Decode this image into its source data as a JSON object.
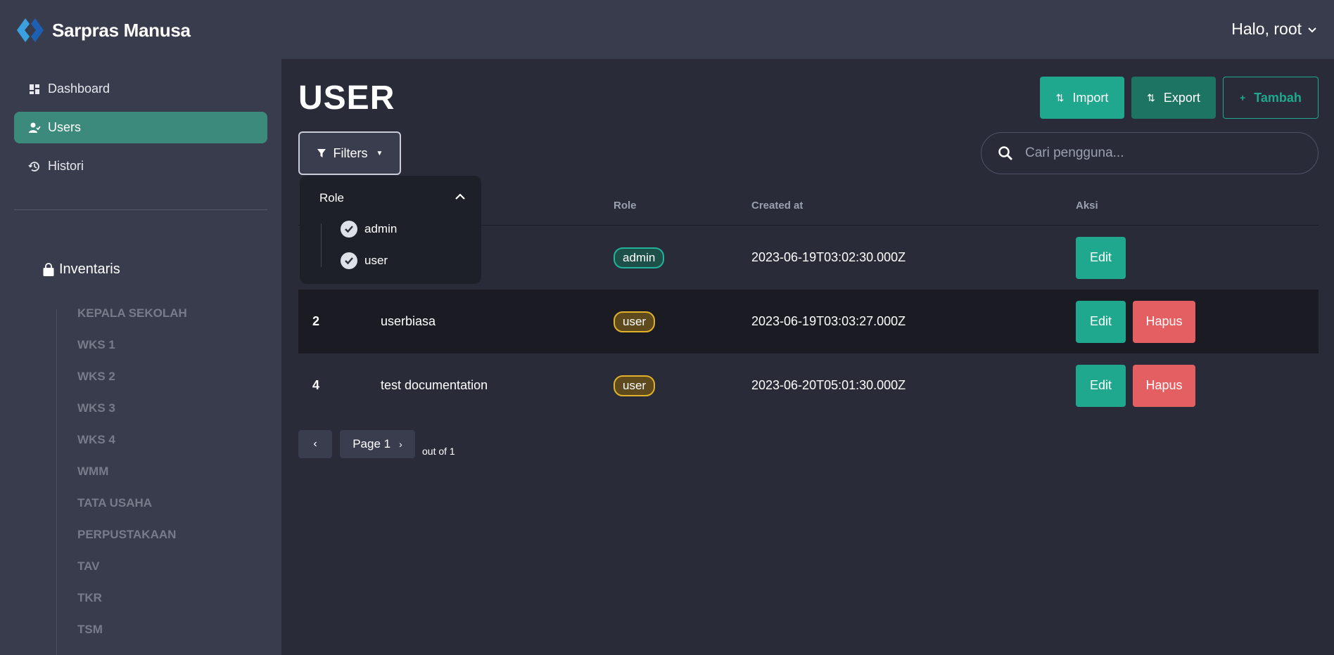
{
  "brand": {
    "name": "Sarpras Manusa",
    "logo_colors": [
      "#3aa0e0",
      "#1d5fb0"
    ]
  },
  "user_menu": {
    "label": "Halo, root"
  },
  "sidebar": {
    "items": [
      {
        "label": "Dashboard",
        "icon": "dashboard-icon"
      },
      {
        "label": "Users",
        "icon": "user-check-icon",
        "active": true
      },
      {
        "label": "Histori",
        "icon": "history-icon"
      }
    ],
    "inventaris": {
      "title": "Inventaris",
      "icon": "bag-icon",
      "items": [
        "KEPALA SEKOLAH",
        "WKS 1",
        "WKS 2",
        "WKS 3",
        "WKS 4",
        "WMM",
        "TATA USAHA",
        "PERPUSTAKAAN",
        "TAV",
        "TKR",
        "TSM"
      ]
    }
  },
  "main": {
    "title": "USER",
    "buttons": {
      "import": "Import",
      "export": "Export",
      "tambah": "Tambah"
    },
    "filters": {
      "label": "Filters",
      "dropdown": {
        "heading": "Role",
        "options": [
          {
            "label": "admin",
            "checked": true
          },
          {
            "label": "user",
            "checked": true
          }
        ]
      }
    },
    "search": {
      "placeholder": "Cari pengguna...",
      "value": ""
    },
    "table": {
      "headers": {
        "role": "Role",
        "created": "Created at",
        "actions": "Aksi"
      },
      "rows": [
        {
          "id": "",
          "name": "",
          "role": "admin",
          "created": "2023-06-19T03:02:30.000Z",
          "edit": "Edit"
        },
        {
          "id": "2",
          "name": "userbiasa",
          "role": "user",
          "created": "2023-06-19T03:03:27.000Z",
          "edit": "Edit",
          "delete": "Hapus"
        },
        {
          "id": "4",
          "name": "test documentation",
          "role": "user",
          "created": "2023-06-20T05:01:30.000Z",
          "edit": "Edit",
          "delete": "Hapus"
        }
      ]
    },
    "pagination": {
      "page_label": "Page 1",
      "of_label": "out of 1"
    }
  },
  "colors": {
    "accent": "#1fa88e",
    "danger": "#e45f62",
    "warning": "#e2b12a",
    "active_nav": "#3c8a7c"
  }
}
